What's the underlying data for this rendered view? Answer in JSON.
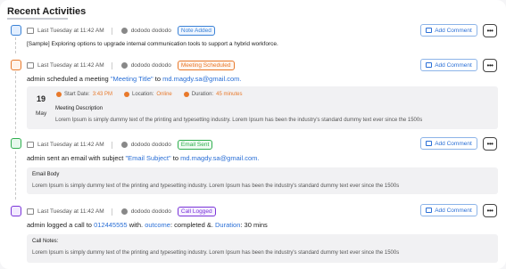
{
  "header": {
    "title": "Recent Activities"
  },
  "activities": [
    {
      "date": "Last Tuesday at 11:42 AM",
      "user": "dododo dododo",
      "badge": "Note Added",
      "comment_label": "Add Comment",
      "text": "[Sample] Exploring options to upgrade internal communication tools to support a hybrid workforce."
    },
    {
      "date": "Last Tuesday at 11:42 AM",
      "user": "dododo dododo",
      "badge": "Meeting Scheduled",
      "comment_label": "Add Comment",
      "line_prefix": "admin scheduled a meeting ",
      "line_title": "\"Meeting Title\"",
      "line_to": " to ",
      "line_email": "md.magdy.sa@gmail.com.",
      "day": "19",
      "month": "May",
      "start_label": "Start Date:",
      "start_value": "3:43 PM",
      "location_label": "Location:",
      "location_value": "Online",
      "duration_label": "Duration:",
      "duration_value": "45 minutes",
      "desc_title": "Meeting Description",
      "desc_text": "Lorem Ipsum is simply dummy text of the printing and typesetting industry. Lorem Ipsum has been the industry's standard dummy text ever since the 1500s"
    },
    {
      "date": "Last Tuesday at 11:42 AM",
      "user": "dododo dododo",
      "badge": "Email Sent",
      "comment_label": "Add Comment",
      "line_prefix": "admin sent an email with subject ",
      "line_title": "\"Email Subject\"",
      "line_to": " to ",
      "line_email": "md.magdy.sa@gmail.com.",
      "body_title": "Email Body",
      "body_text": "Lorem Ipsum is simply dummy text of the printing and typesetting industry. Lorem Ipsum has been the industry's standard dummy text ever since the 1500s"
    },
    {
      "date": "Last Tuesday at 11:42 AM",
      "user": "dododo dododo",
      "badge": "Call Logged",
      "comment_label": "Add Comment",
      "line_prefix": "admin logged a call to ",
      "line_number": "012445555",
      "line_with": " with. ",
      "line_outcome_label": "outcome",
      "line_outcome_value": ": completed &. ",
      "line_duration_label": "Duration",
      "line_duration_value": ": 30 mins",
      "notes_title": "Call Notes:",
      "notes_text": "Lorem Ipsum is simply dummy text of the printing and typesetting industry. Lorem Ipsum has been the industry's standard dummy text ever since the 1500s"
    }
  ],
  "colors": {
    "note": "#3b82d6",
    "meeting": "#e8792b",
    "email": "#2fae4e",
    "call": "#7a35d8",
    "link": "#2a6fd6"
  }
}
